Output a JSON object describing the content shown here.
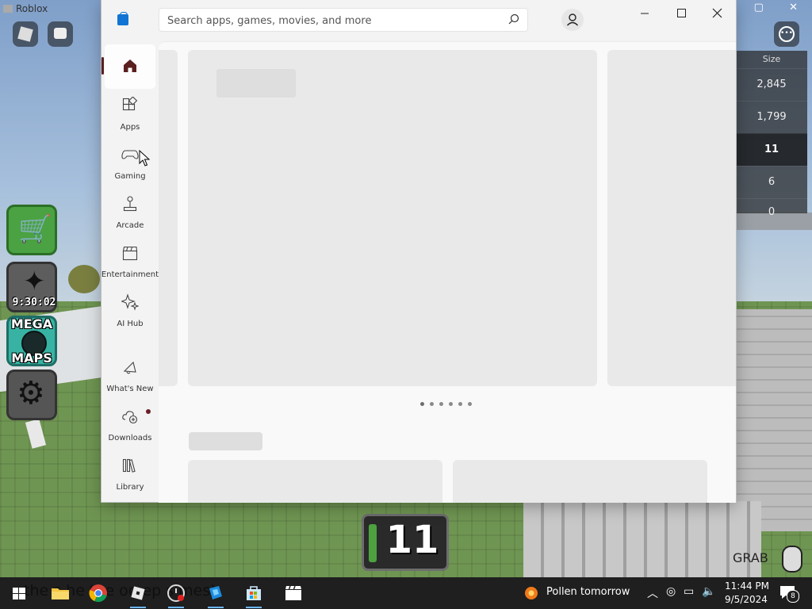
{
  "roblox": {
    "window_title": "Roblox",
    "leaderboard": {
      "header": "Size",
      "rows": [
        "2,845",
        "1,799",
        "11",
        "6",
        "0"
      ]
    },
    "boost_timer": "9:30:02",
    "maps_label_top": "MEGA",
    "maps_label_bottom": "MAPS",
    "counter": "11",
    "grab_label": "GRAB"
  },
  "store": {
    "search_placeholder": "Search apps, games, movies, and more",
    "nav": [
      {
        "label": "",
        "icon": "home-icon",
        "active": true
      },
      {
        "label": "Apps",
        "icon": "apps-icon"
      },
      {
        "label": "Gaming",
        "icon": "gamepad-icon"
      },
      {
        "label": "Arcade",
        "icon": "joystick-icon"
      },
      {
        "label": "Entertainment",
        "icon": "clapperboard-icon"
      },
      {
        "label": "AI Hub",
        "icon": "sparkle-icon"
      },
      {
        "label": "What's New",
        "icon": "megaphone-icon"
      },
      {
        "label": "Downloads",
        "icon": "cloud-download-icon"
      },
      {
        "label": "Library",
        "icon": "library-icon"
      }
    ],
    "carousel_page": 1,
    "carousel_pages": 6,
    "colors": {
      "accent": "#5b1f1f",
      "placeholder": "#e9e9e9"
    }
  },
  "taskbar": {
    "ghost_text": "the s   he   the   oo   ep   s   mes)",
    "weather": "Pollen tomorrow",
    "time": "11:44 PM",
    "date": "9/5/2024",
    "notifications": "8"
  }
}
